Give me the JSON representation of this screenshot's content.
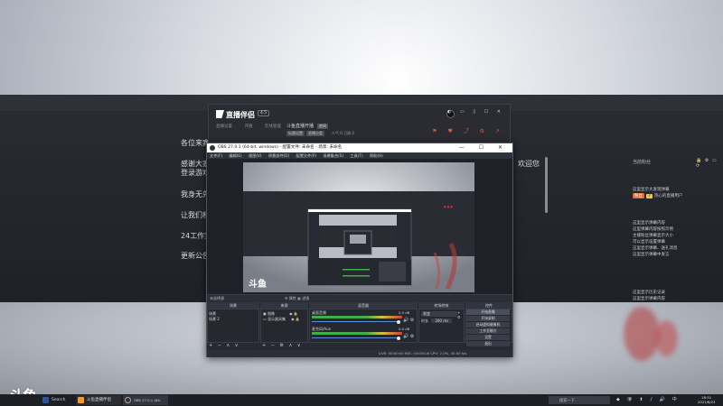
{
  "background_page": {
    "lines": [
      "各位来宾",
      "感谢大家",
      "登录游戏",
      "我身无先",
      "让我们相",
      "24工作室",
      "更新公告"
    ],
    "line_right": "，欢迎您"
  },
  "side_panel": {
    "title": "当前粉丝",
    "icons": "🔒 ⚙ ▭ ⟳",
    "lines": [
      "这里显示大发现弹幕",
      "这里显示弹幕内容",
      "这里弹幕内容按照示例",
      "主播粉丝弹幕显示大小",
      "可以显示设置弹幕",
      "这里显示弹幕、送礼消息",
      "这里显示弹幕中发言",
      "这里显示历史记录",
      "这里显示弹幕内容"
    ],
    "badge1": "粉丝",
    "badge2": "7",
    "badge_user": "热心的直播用户"
  },
  "companion": {
    "logo": "直播伴侣",
    "version": "4.5",
    "menu": [
      "直播设置",
      "开播",
      "在线管理"
    ],
    "room_title": "斗鱼直播开播",
    "room_tag": "房间",
    "sub_tags": [
      "标题设置",
      "直播分类"
    ],
    "stats": "人气 0    订阅 0    ",
    "ctrls": "◐ ▭ ▯ ☐ ✕",
    "actions": "⚑ ♥ ⤴ ⚙ ↗"
  },
  "obs": {
    "title": "OBS 27.0.1 (64-bit, windows) - 配置文件: 未命名 - 场景: 未命名",
    "win_buttons": "— ☐ ✕",
    "menu": [
      "文件(F)",
      "编辑(E)",
      "视图(V)",
      "停靠部件(D)",
      "配置文件(P)",
      "场景集合(S)",
      "工具(T)",
      "帮助(H)"
    ],
    "toolbar_left": "未选择源",
    "toolbar_mid": "⚙ 属性   ▦ 滤镜",
    "docks": {
      "scenes": "场景",
      "sources": "来源",
      "mixer": "混音器",
      "transitions": "转场特效",
      "controls": "控件"
    },
    "scenes_items": [
      "场景",
      "场景 2"
    ],
    "sources_items": [
      "图像",
      "显示器采集"
    ],
    "mixer_rows": [
      {
        "name": "桌面音频",
        "db": "0.0 dB"
      },
      {
        "name": "麦克风/Aux",
        "db": "0.0 dB"
      }
    ],
    "transition": {
      "type": "渐变",
      "duration_label": "时长",
      "duration": "300 ms"
    },
    "controls": [
      "开始直播",
      "开始录制",
      "启动虚拟摄像机",
      "工作室模式",
      "设置",
      "退出"
    ],
    "status": "LIVE: 00:00:00    REC: 00:00:00    CPU: 2.0%, 30.00 fps",
    "dock_footer": "+ − ∧ ∨"
  },
  "douyu_logo": "斗鱼",
  "taskbar": {
    "items": [
      {
        "label": "Search",
        "color": "#2b579a"
      },
      {
        "label": "斗鱼直播伴侣",
        "color": "#f29b2a"
      },
      {
        "label": "OBS 27.0.1 (64-bit...",
        "color": "#303236"
      }
    ],
    "search": "搜索一下",
    "tray": "◆ 🛡 ⬆ ♪ 🔊 中",
    "clock": "18:51",
    "date": "2021/8/23"
  }
}
